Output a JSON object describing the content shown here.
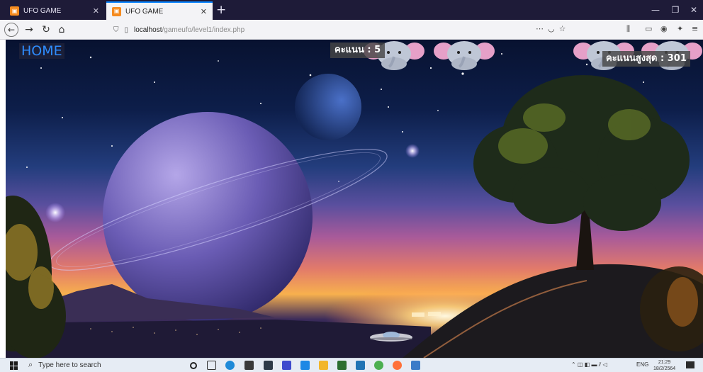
{
  "browser": {
    "tabs": [
      {
        "label": "UFO GAME",
        "active": false
      },
      {
        "label": "UFO GAME",
        "active": true
      }
    ],
    "new_tab_glyph": "+",
    "url_host": "localhost",
    "url_path": "/gameufo/level1/index.php",
    "icons": [
      "back-icon",
      "forward-icon",
      "reload-icon",
      "home-icon",
      "shield-icon",
      "page-icon",
      "more-icon",
      "pocket-icon",
      "star-icon",
      "library-icon",
      "sidebar-icon",
      "account-icon",
      "extension-icon",
      "menu-icon"
    ]
  },
  "game": {
    "home_label": "HOME",
    "score_label": "คะแนน : 5",
    "high_score_label": "คะแนนสูงสุด : 301",
    "sprite_count_visible": 4
  },
  "taskbar": {
    "search_placeholder": "Type here to search",
    "tray_lang": "ENG",
    "time": "21:29",
    "date": "18/2/2564"
  },
  "colors": {
    "home_text": "#2e8cff",
    "tab_accent": "#0a84ff",
    "favicon": "#f58b1f"
  }
}
